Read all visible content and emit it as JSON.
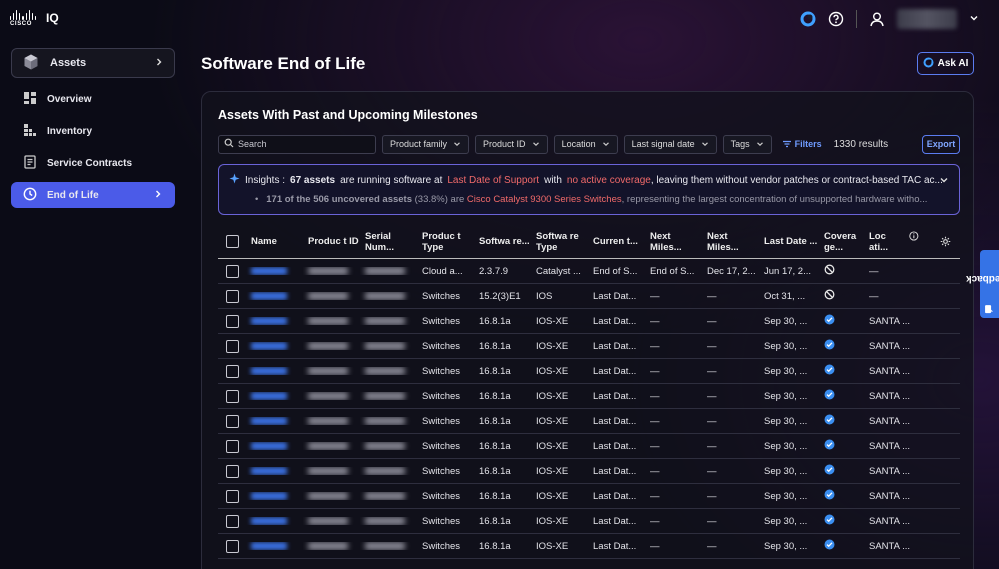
{
  "brand": {
    "logo_text": "CISCO",
    "product": "IQ"
  },
  "header": {
    "icons": [
      "cisco-assistant-icon",
      "help-icon",
      "user-icon",
      "chevron-down-icon"
    ]
  },
  "sidebar": {
    "assets_label": "Assets",
    "items": [
      {
        "label": "Overview",
        "icon": "overview-icon"
      },
      {
        "label": "Inventory",
        "icon": "inventory-icon"
      },
      {
        "label": "Service Contracts",
        "icon": "contracts-icon"
      },
      {
        "label": "End of Life",
        "icon": "clock-icon",
        "active": true
      }
    ]
  },
  "main": {
    "title": "Software End of Life",
    "ask_ai_label": "Ask AI",
    "panel_title": "Assets With Past and Upcoming Milestones",
    "search_placeholder": "Search",
    "filters": [
      "Product family",
      "Product ID",
      "Location",
      "Last signal date",
      "Tags"
    ],
    "filters_label": "Filters",
    "results": "1330 results",
    "export_label": "Export"
  },
  "insights": {
    "label": "Insights :",
    "count": "67 assets",
    "t1": "are running software at",
    "link1": "Last Date of Support",
    "t2": "with",
    "link2": "no active coverage",
    "t3": ", leaving them without vendor patches or contract-based TAC ac...",
    "bullet_bold": "171 of the 506 uncovered assets",
    "bullet_t1": "(33.8%) are",
    "bullet_link": "Cisco Catalyst 9300 Series Switches",
    "bullet_t2": ", representing the largest concentration of unsupported hardware witho..."
  },
  "table": {
    "headers": {
      "name": "Name",
      "pid": "Produc t ID",
      "serial": "Serial Num...",
      "ptype": "Produc t Type",
      "software": "Softwa re...",
      "swtype": "Softwa re Type",
      "current": "Curren t...",
      "next1": "Next Miles...",
      "next2": "Next Miles...",
      "last": "Last Date ...",
      "coverage": "Covera ge...",
      "location": "Loc ati..."
    },
    "rows": [
      {
        "ptype": "Cloud a...",
        "sw": "2.3.7.9",
        "swtype": "Catalyst ...",
        "cur": "End of S...",
        "n1": "End of S...",
        "n2": "Dec 17, 2...",
        "last": "Jun 17, 2...",
        "coverage": "none",
        "loc": "—"
      },
      {
        "ptype": "Switches",
        "sw": "15.2(3)E1",
        "swtype": "IOS",
        "cur": "Last Dat...",
        "n1": "—",
        "n2": "—",
        "last": "Oct 31, ...",
        "coverage": "none",
        "loc": "—"
      },
      {
        "ptype": "Switches",
        "sw": "16.8.1a",
        "swtype": "IOS-XE",
        "cur": "Last Dat...",
        "n1": "—",
        "n2": "—",
        "last": "Sep 30, ...",
        "coverage": "covered",
        "loc": "SANTA ..."
      },
      {
        "ptype": "Switches",
        "sw": "16.8.1a",
        "swtype": "IOS-XE",
        "cur": "Last Dat...",
        "n1": "—",
        "n2": "—",
        "last": "Sep 30, ...",
        "coverage": "covered",
        "loc": "SANTA ..."
      },
      {
        "ptype": "Switches",
        "sw": "16.8.1a",
        "swtype": "IOS-XE",
        "cur": "Last Dat...",
        "n1": "—",
        "n2": "—",
        "last": "Sep 30, ...",
        "coverage": "covered",
        "loc": "SANTA ..."
      },
      {
        "ptype": "Switches",
        "sw": "16.8.1a",
        "swtype": "IOS-XE",
        "cur": "Last Dat...",
        "n1": "—",
        "n2": "—",
        "last": "Sep 30, ...",
        "coverage": "covered",
        "loc": "SANTA ..."
      },
      {
        "ptype": "Switches",
        "sw": "16.8.1a",
        "swtype": "IOS-XE",
        "cur": "Last Dat...",
        "n1": "—",
        "n2": "—",
        "last": "Sep 30, ...",
        "coverage": "covered",
        "loc": "SANTA ..."
      },
      {
        "ptype": "Switches",
        "sw": "16.8.1a",
        "swtype": "IOS-XE",
        "cur": "Last Dat...",
        "n1": "—",
        "n2": "—",
        "last": "Sep 30, ...",
        "coverage": "covered",
        "loc": "SANTA ..."
      },
      {
        "ptype": "Switches",
        "sw": "16.8.1a",
        "swtype": "IOS-XE",
        "cur": "Last Dat...",
        "n1": "—",
        "n2": "—",
        "last": "Sep 30, ...",
        "coverage": "covered",
        "loc": "SANTA ..."
      },
      {
        "ptype": "Switches",
        "sw": "16.8.1a",
        "swtype": "IOS-XE",
        "cur": "Last Dat...",
        "n1": "—",
        "n2": "—",
        "last": "Sep 30, ...",
        "coverage": "covered",
        "loc": "SANTA ..."
      },
      {
        "ptype": "Switches",
        "sw": "16.8.1a",
        "swtype": "IOS-XE",
        "cur": "Last Dat...",
        "n1": "—",
        "n2": "—",
        "last": "Sep 30, ...",
        "coverage": "covered",
        "loc": "SANTA ..."
      },
      {
        "ptype": "Switches",
        "sw": "16.8.1a",
        "swtype": "IOS-XE",
        "cur": "Last Dat...",
        "n1": "—",
        "n2": "—",
        "last": "Sep 30, ...",
        "coverage": "covered",
        "loc": "SANTA ..."
      }
    ]
  },
  "feedback_label": "Feedback",
  "colors": {
    "accent": "#4b5be8",
    "link": "#f16a6a",
    "covered": "#3a8ef0"
  }
}
